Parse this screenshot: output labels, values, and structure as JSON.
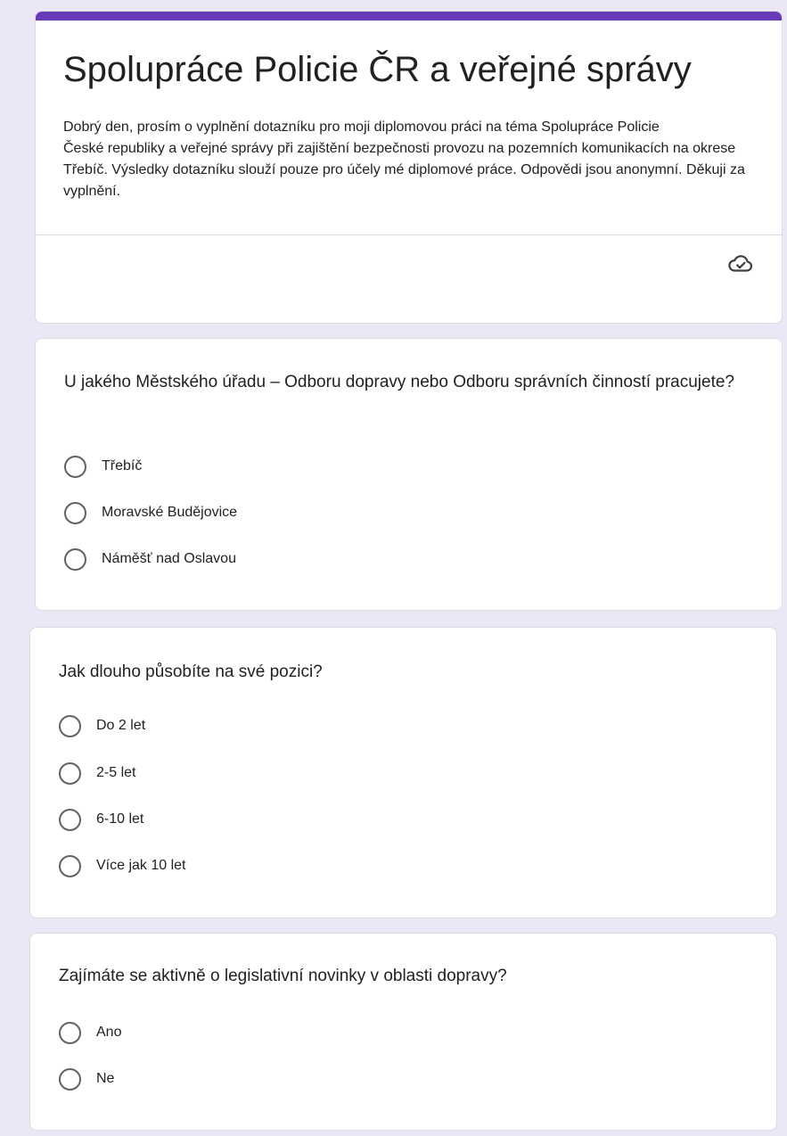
{
  "form": {
    "title": "Spolupráce Policie ČR a veřejné správy",
    "description_lines": [
      "Dobrý den, prosím o vyplnění dotazníku pro moji diplomovou práci na téma Spolupráce Policie",
      "České republiky a veřejné správy při zajištění bezpečnosti provozu na pozemních komunikacích na okrese Třebíč. Výsledky dotazníku slouží pouze pro účely mé diplomové práce. Odpovědi jsou anonymní. Děkuji za vyplnění."
    ],
    "status_icon": "cloud-check-icon",
    "accent_color": "#673ab7"
  },
  "questions": [
    {
      "title": "U jakého Městského úřadu – Odboru dopravy nebo Odboru správních činností pracujete?",
      "options": [
        "Třebíč",
        "Moravské Budějovice",
        "Náměšť nad Oslavou"
      ]
    },
    {
      "title": "Jak dlouho působíte na své pozici?",
      "options": [
        "Do 2 let",
        "2-5 let",
        "6-10 let",
        "Více jak 10 let"
      ]
    },
    {
      "title": "Zajímáte se aktivně o legislativní novinky v oblasti dopravy?",
      "options": [
        "Ano",
        "Ne"
      ]
    }
  ]
}
